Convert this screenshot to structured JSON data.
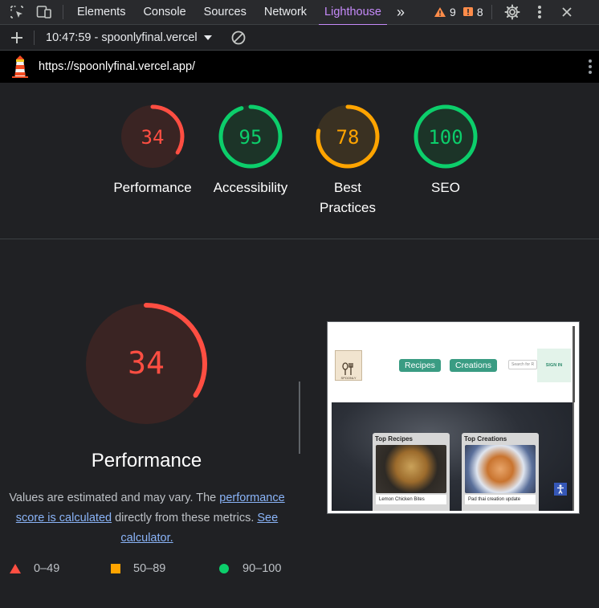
{
  "devtools": {
    "tabs": [
      "Elements",
      "Console",
      "Sources",
      "Network",
      "Lighthouse"
    ],
    "active_tab": "Lighthouse",
    "more_tabs_glyph": "»",
    "warning_count": "9",
    "issue_count": "8"
  },
  "report_toolbar": {
    "report_label": "10:47:59 - spoonlyfinal.vercel"
  },
  "url_bar": {
    "url": "https://spoonlyfinal.vercel.app/"
  },
  "gauges": [
    {
      "score": "34",
      "label": "Performance",
      "value": 0.34,
      "color": "#ff4e42",
      "bg": "#3a2423"
    },
    {
      "score": "95",
      "label": "Accessibility",
      "value": 0.95,
      "color": "#0cce6b",
      "bg": "#1c3428"
    },
    {
      "score": "78",
      "label": "Best Practices",
      "value": 0.78,
      "color": "#ffa400",
      "bg": "#3a3122"
    },
    {
      "score": "100",
      "label": "SEO",
      "value": 1.0,
      "color": "#0cce6b",
      "bg": "#1c3428"
    }
  ],
  "performance": {
    "score": "34",
    "value": 0.34,
    "title": "Performance",
    "desc_prefix": "Values are estimated and may vary. The ",
    "desc_link": "performance score is calculated",
    "desc_middle": " directly from these metrics. ",
    "desc_link2": "See calculator."
  },
  "legend": [
    {
      "range": "0–49",
      "shape": "triangle",
      "color": "#ff4e42"
    },
    {
      "range": "50–89",
      "shape": "square",
      "color": "#ffa400"
    },
    {
      "range": "90–100",
      "shape": "circle",
      "color": "#0cce6b"
    }
  ],
  "thumbnail": {
    "logo_text": "SPOONLY",
    "nav_recipes": "Recipes",
    "nav_creations": "Creations",
    "search_placeholder": "Search for R",
    "sign_in": "SIGN IN",
    "card1_title": "Top Recipes",
    "card1_caption": "Lemon Chicken Bites",
    "card2_title": "Top Creations",
    "card2_caption": "Pad thai creation update"
  }
}
